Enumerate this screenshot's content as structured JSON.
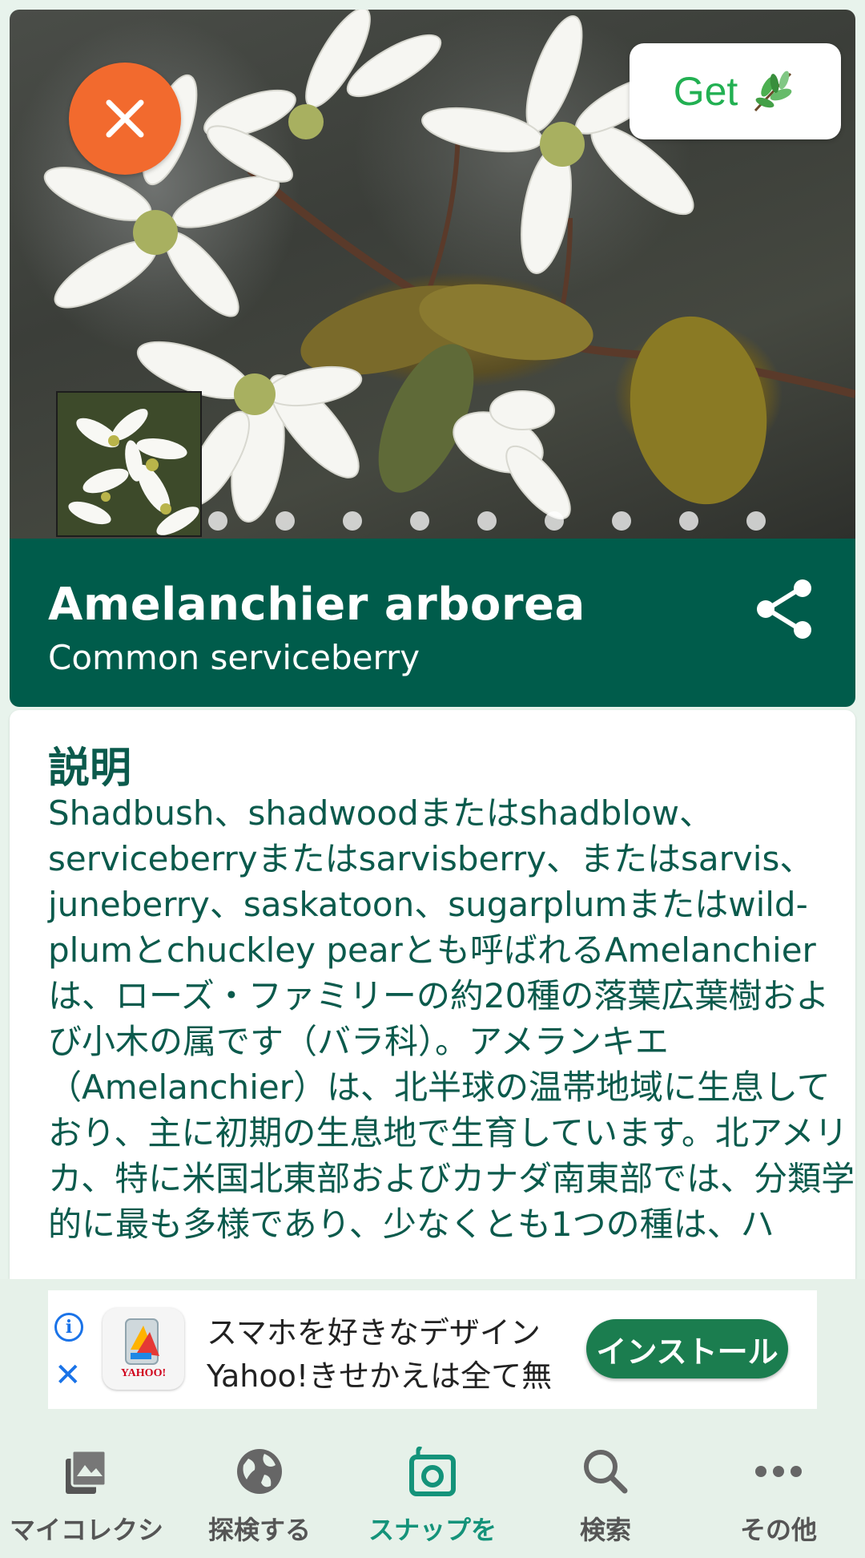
{
  "hero": {
    "get_label": "Get",
    "page_count": 9,
    "icons": {
      "close": "close-icon",
      "get": "leaf-icon"
    }
  },
  "plant": {
    "scientific_name": "Amelanchier arborea",
    "common_name": "Common serviceberry",
    "share_icon": "share-icon"
  },
  "description": {
    "heading": "説明",
    "text": "Shadbush、shadwoodまたはshadblow、serviceberryまたはsarvisberry、またはsarvis、juneberry、saskatoon、sugarplumまたはwild-plumとchuckley pearとも呼ばれるAmelanchierは、ローズ・ファミリーの約20種の落葉広葉樹および小木の属です（バラ科）。アメランキエ（Amelanchier）は、北半球の温帯地域に生息しており、主に初期の生息地で生育しています。北アメリカ、特に米国北東部およびカナダ南東部では、分類学的に最も多様であり、少なくとも1つの種は、ハ"
  },
  "ad": {
    "line1": "スマホを好きなデザイン",
    "line2": "Yahoo!きせかえは全て無",
    "icon_label": "YAHOO!",
    "install_label": "インストール"
  },
  "nav": {
    "items": [
      {
        "label": "マイコレクシ",
        "icon": "collection-icon"
      },
      {
        "label": "探検する",
        "icon": "globe-icon"
      },
      {
        "label": "スナップを",
        "icon": "camera-icon"
      },
      {
        "label": "検索",
        "icon": "search-icon"
      },
      {
        "label": "その他",
        "icon": "more-icon"
      }
    ],
    "active_index": 2
  },
  "colors": {
    "title_bar": "#005c4b",
    "close_button": "#f26a2e",
    "get_text": "#22b052",
    "nav_active": "#14937a",
    "install_button": "#1b7d4f"
  }
}
